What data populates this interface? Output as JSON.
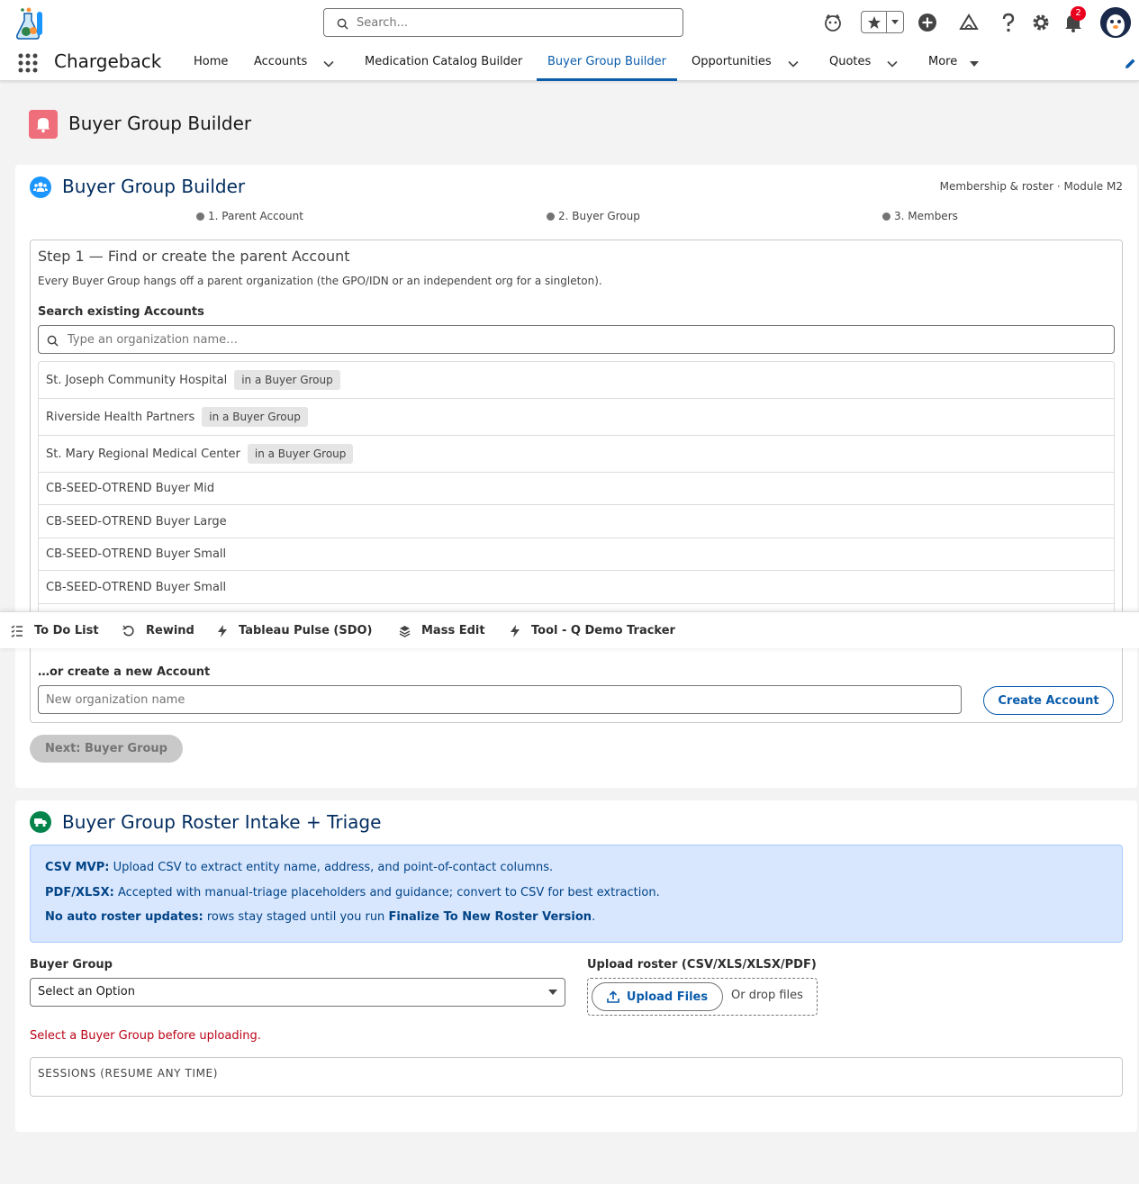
{
  "header": {
    "search_placeholder": "Search...",
    "notification_count": "2"
  },
  "nav": {
    "app_name": "Chargeback",
    "items": [
      {
        "label": "Home"
      },
      {
        "label": "Accounts"
      },
      {
        "label": "Medication Catalog Builder"
      },
      {
        "label": "Buyer Group Builder"
      },
      {
        "label": "Opportunities"
      },
      {
        "label": "Quotes"
      },
      {
        "label": "More"
      }
    ]
  },
  "page": {
    "title": "Buyer Group Builder"
  },
  "builder": {
    "title": "Buyer Group Builder",
    "meta": "Membership & roster · Module M2",
    "steps": [
      {
        "label": "1. Parent Account"
      },
      {
        "label": "2. Buyer Group"
      },
      {
        "label": "3. Members"
      }
    ],
    "step1": {
      "heading": "Step 1 — Find or create the parent Account",
      "subtitle": "Every Buyer Group hangs off a parent organization (the GPO/IDN or an independent org for a singleton).",
      "search_label": "Search existing Accounts",
      "search_placeholder": "Type an organization name…",
      "results": [
        {
          "name": "St. Joseph Community Hospital",
          "badge": "in a Buyer Group"
        },
        {
          "name": "Riverside Health Partners",
          "badge": "in a Buyer Group"
        },
        {
          "name": "St. Mary Regional Medical Center",
          "badge": "in a Buyer Group"
        },
        {
          "name": "CB-SEED-OTREND Buyer Mid"
        },
        {
          "name": "CB-SEED-OTREND Buyer Large"
        },
        {
          "name": "CB-SEED-OTREND Buyer Small"
        },
        {
          "name": "CB-SEED-OTREND Buyer Small"
        }
      ],
      "create_label": "…or create a new Account",
      "create_placeholder": "New organization name",
      "create_button": "Create Account"
    },
    "next_button": "Next: Buyer Group"
  },
  "utility_bar": {
    "items": [
      {
        "label": "To Do List",
        "icon": "checklist-icon"
      },
      {
        "label": "Rewind",
        "icon": "rewind-icon"
      },
      {
        "label": "Tableau Pulse (SDO)",
        "icon": "bolt-icon"
      },
      {
        "label": "Mass Edit",
        "icon": "layers-icon"
      },
      {
        "label": "Tool - Q Demo Tracker",
        "icon": "bolt-icon"
      }
    ]
  },
  "roster": {
    "title": "Buyer Group Roster Intake + Triage",
    "info": {
      "line1_bold": "CSV MVP:",
      "line1_text": " Upload CSV to extract entity name, address, and point-of-contact columns.",
      "line2_bold": "PDF/XLSX:",
      "line2_text": " Accepted with manual-triage placeholders and guidance; convert to CSV for best extraction.",
      "line3_bold": "No auto roster updates:",
      "line3_text": " rows stay staged until you run ",
      "line3_bold2": "Finalize To New Roster Version",
      "line3_end": "."
    },
    "buyer_group_label": "Buyer Group",
    "buyer_group_value": "Select an Option",
    "upload_label": "Upload roster (CSV/XLS/XLSX/PDF)",
    "upload_button": "Upload Files",
    "drop_text": "Or drop files",
    "error_text": "Select a Buyer Group before uploading.",
    "sessions_label": "SESSIONS (RESUME ANY TIME)"
  },
  "colors": {
    "brand": "#0b5cab",
    "page_icon": "#ef6e7b",
    "builder_icon": "#1b96ff",
    "roster_icon": "#04844b",
    "error": "#ba0517"
  }
}
